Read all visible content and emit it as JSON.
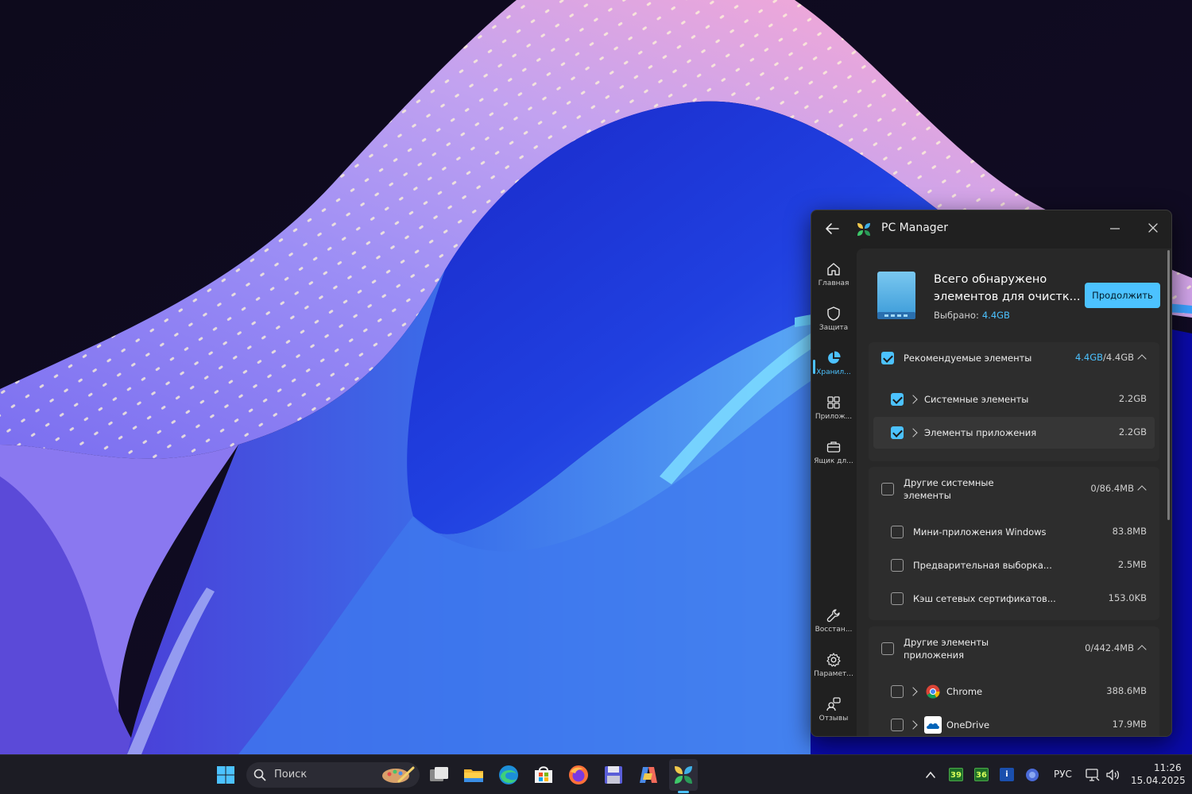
{
  "window": {
    "title": "PC Manager",
    "back_icon": "arrow-left-icon",
    "minimize_icon": "minimize-icon",
    "close_icon": "close-icon"
  },
  "sidebar": {
    "items": [
      {
        "label": "Главная",
        "icon": "home-icon"
      },
      {
        "label": "Защита",
        "icon": "shield-icon"
      },
      {
        "label": "Хранил...",
        "icon": "pie-chart-icon",
        "active": true
      },
      {
        "label": "Прилож...",
        "icon": "apps-icon"
      },
      {
        "label": "Ящик дл...",
        "icon": "toolbox-icon"
      },
      {
        "label": "Восстан...",
        "icon": "wrench-icon"
      },
      {
        "label": "Парамет...",
        "icon": "gear-icon"
      },
      {
        "label": "Отзывы",
        "icon": "feedback-icon"
      }
    ]
  },
  "summary": {
    "title_line1": "Всего обнаружено",
    "title_line2": "элементов для очистк...",
    "selected_label": "Выбрано:",
    "selected_value": "4.4GB",
    "continue_button": "Продолжить"
  },
  "groups": [
    {
      "label": "Рекомендуемые элементы",
      "size_selected": "4.4GB",
      "size_total": "/4.4GB",
      "checked": true,
      "items": [
        {
          "label": "Системные элементы",
          "size": "2.2GB",
          "checked": true,
          "expandable": true
        },
        {
          "label": "Элементы приложения",
          "size": "2.2GB",
          "checked": true,
          "expandable": true
        }
      ]
    },
    {
      "label_line1": "Другие системные",
      "label_line2": "элементы",
      "size": "0/86.4MB",
      "checked": false,
      "items": [
        {
          "label": "Мини-приложения Windows",
          "size": "83.8MB",
          "checked": false
        },
        {
          "label": "Предварительная выборка...",
          "size": "2.5MB",
          "checked": false
        },
        {
          "label": "Кэш сетевых сертификатов...",
          "size": "153.0KB",
          "checked": false
        }
      ]
    },
    {
      "label_line1": "Другие элементы",
      "label_line2": "приложения",
      "size": "0/442.4MB",
      "checked": false,
      "items": [
        {
          "label": "Chrome",
          "size": "388.6MB",
          "checked": false,
          "expandable": true,
          "icon": "chrome-icon"
        },
        {
          "label": "OneDrive",
          "size": "17.9MB",
          "checked": false,
          "expandable": true,
          "icon": "onedrive-icon"
        }
      ]
    }
  ],
  "taskbar": {
    "search_placeholder": "Поиск",
    "apps": [
      "start-icon",
      "task-view-icon",
      "file-explorer-icon",
      "edge-icon",
      "store-icon",
      "firefox-icon",
      "save-icon",
      "copilot-icon",
      "pc-manager-icon"
    ],
    "tray": {
      "badge1": "39",
      "badge2": "36",
      "info_badge": "i",
      "language": "РУС",
      "time": "11:26",
      "date": "15.04.2025"
    }
  },
  "colors": {
    "accent": "#4cc2ff",
    "window_bg": "#202020",
    "content_bg": "#282828",
    "group_bg": "#2d2d2d",
    "taskbar_bg": "#1c1c24"
  }
}
